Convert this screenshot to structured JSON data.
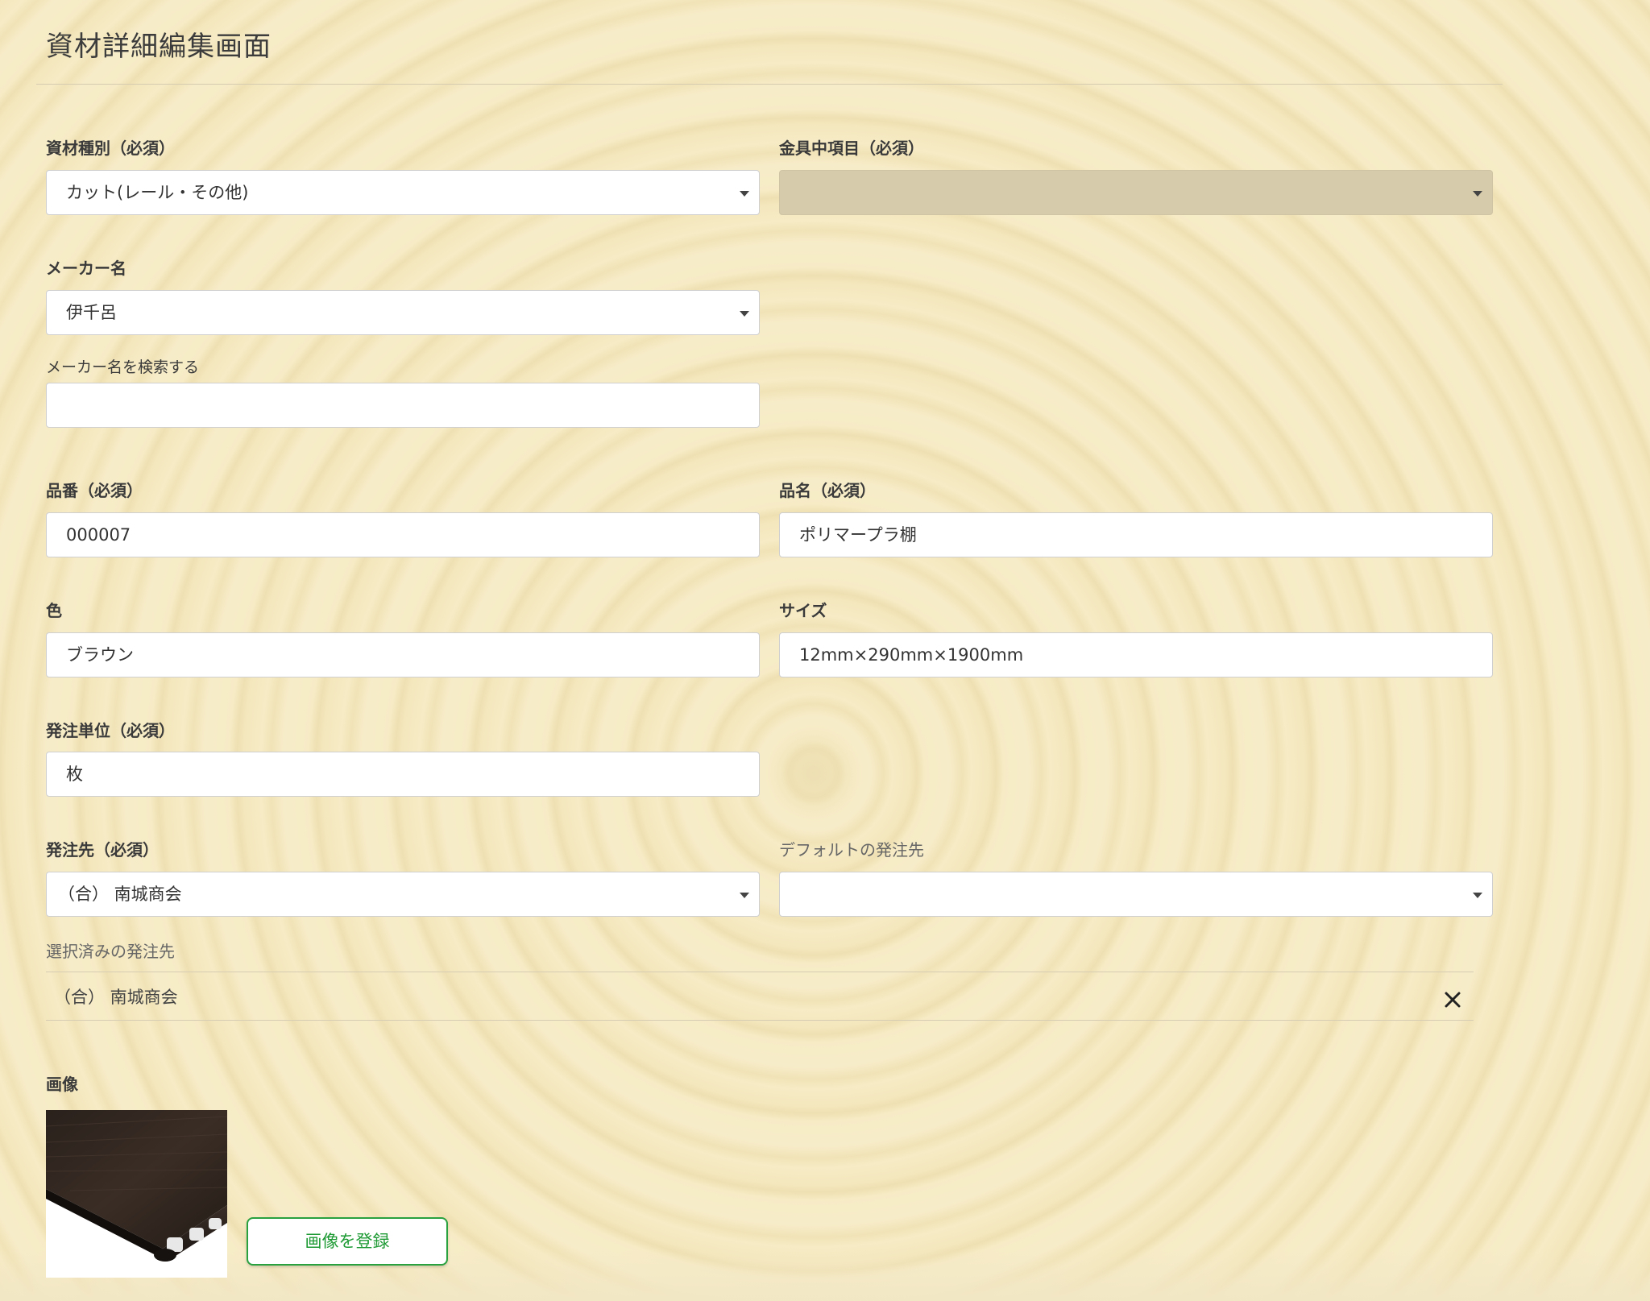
{
  "page": {
    "title": "資材詳細編集画面"
  },
  "form": {
    "material_type": {
      "label": "資材種別（必須）",
      "value": "カット(レール・その他)"
    },
    "hardware_category": {
      "label": "金具中項目（必須）",
      "value": ""
    },
    "maker": {
      "label": "メーカー名",
      "value": "伊千呂"
    },
    "maker_search": {
      "label": "メーカー名を検索する",
      "value": ""
    },
    "product_code": {
      "label": "品番（必須）",
      "value": "000007"
    },
    "product_name": {
      "label": "品名（必須）",
      "value": "ポリマープラ棚"
    },
    "color": {
      "label": "色",
      "value": "ブラウン"
    },
    "size": {
      "label": "サイズ",
      "value": "12mm×290mm×1900mm"
    },
    "order_unit": {
      "label": "発注単位（必須）",
      "value": "枚"
    },
    "supplier": {
      "label": "発注先（必須）",
      "value": "（合） 南城商会"
    },
    "default_supplier": {
      "label": "デフォルトの発注先",
      "value": ""
    },
    "selected_suppliers": {
      "label": "選択済みの発注先",
      "items": [
        {
          "name": "（合） 南城商会"
        }
      ]
    },
    "image": {
      "label": "画像",
      "upload_label": "画像を登録"
    }
  },
  "icons": {
    "select_caret": "caret-down-icon",
    "remove": "close-icon"
  },
  "colors": {
    "accent_green": "#29a13f",
    "disabled_field": "#d6cbab",
    "background": "#f7ecc6"
  }
}
